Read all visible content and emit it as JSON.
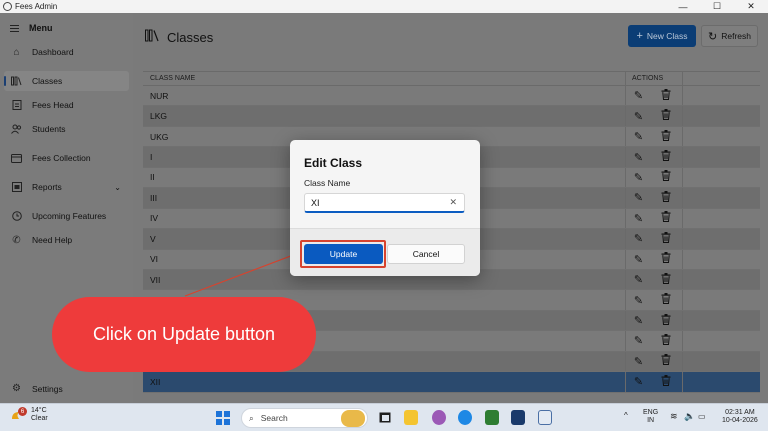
{
  "window": {
    "title": "Fees Admin",
    "controls": [
      "—",
      "☐",
      "✕"
    ]
  },
  "sidebar": {
    "menu_label": "Menu",
    "items": [
      {
        "label": "Dashboard",
        "icon": "home-icon"
      },
      {
        "label": "Classes",
        "icon": "library-icon",
        "active": true
      },
      {
        "label": "Fees Head",
        "icon": "document-icon"
      },
      {
        "label": "Students",
        "icon": "people-icon"
      },
      {
        "label": "Fees Collection",
        "icon": "wallet-icon"
      },
      {
        "label": "Reports",
        "icon": "report-icon",
        "expandable": true
      },
      {
        "label": "Upcoming Features",
        "icon": "clock-icon"
      },
      {
        "label": "Need Help",
        "icon": "phone-icon"
      }
    ],
    "settings_label": "Settings"
  },
  "main": {
    "title": "Classes",
    "new_button": "New Class",
    "refresh_button": "Refresh",
    "columns": {
      "name": "CLASS NAME",
      "actions": "ACTIONS"
    },
    "rows": [
      "NUR",
      "LKG",
      "UKG",
      "I",
      "II",
      "III",
      "IV",
      "V",
      "VI",
      "VII",
      "",
      "",
      "",
      "",
      "XII"
    ],
    "selected_row": "XII"
  },
  "dialog": {
    "title": "Edit Class",
    "field_label": "Class Name",
    "field_value": "XI",
    "update_button": "Update",
    "cancel_button": "Cancel"
  },
  "annotation": {
    "callout_text": "Click on Update button",
    "callout_color": "#ee3b3b",
    "highlight_color": "#d7432e"
  },
  "taskbar": {
    "weather_temp": "14°C",
    "weather_desc": "Clear",
    "weather_badge": "6",
    "search_placeholder": "Search",
    "lang_top": "ENG",
    "lang_bottom": "IN",
    "time": "02:31 AM",
    "date": "10-04-2026"
  },
  "colors": {
    "accent": "#0a5ac0",
    "selected_row": "#2b4a6e"
  }
}
